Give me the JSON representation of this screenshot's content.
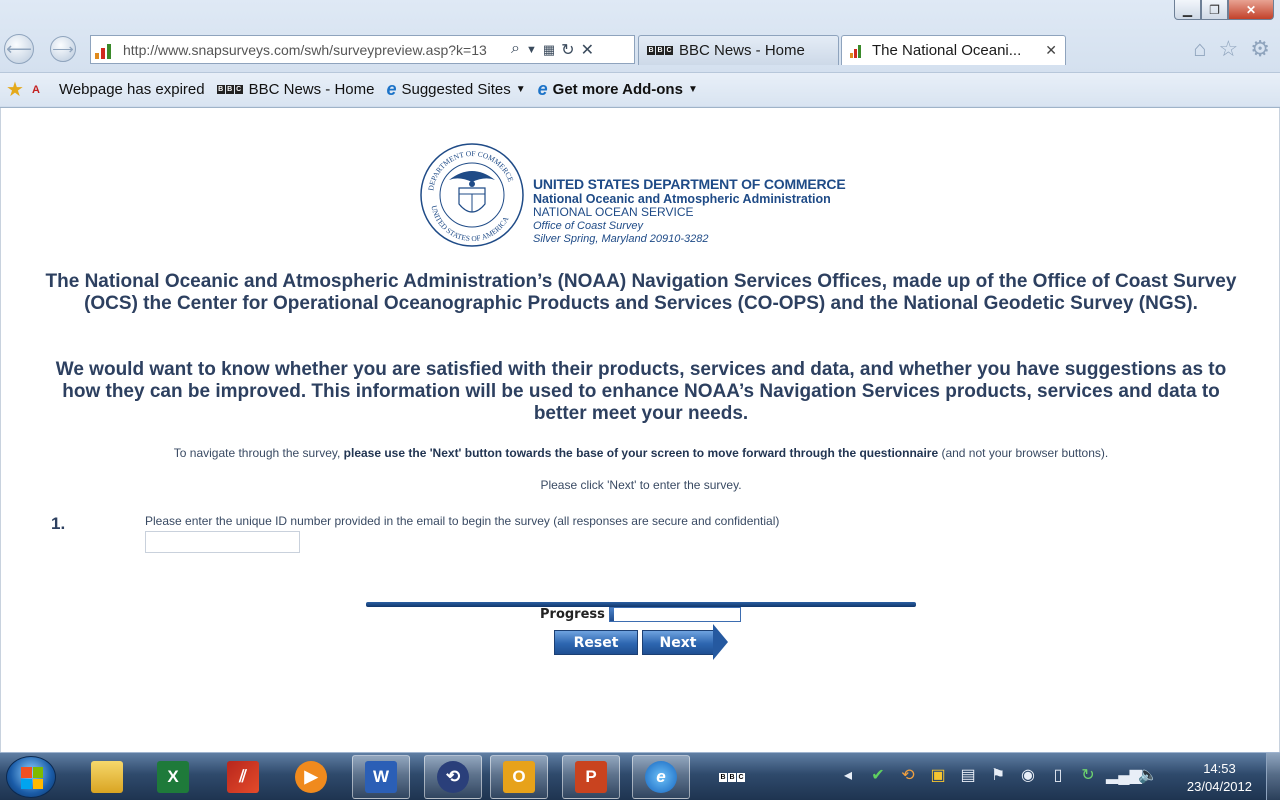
{
  "browser": {
    "address_url": "http://www.snapsurveys.com/swh/surveypreview.asp?k=13",
    "tabs": [
      {
        "label": "BBC News - Home"
      },
      {
        "label": "The National Oceani..."
      }
    ],
    "favorites": [
      {
        "label": "Webpage has expired",
        "icon": "expired-page-icon"
      },
      {
        "label": "BBC News - Home",
        "icon": "bbc-icon"
      },
      {
        "label": "Suggested Sites",
        "icon": "ie-icon"
      },
      {
        "label": "Get more Add-ons",
        "icon": "ie-icon"
      }
    ],
    "bbc_letters": [
      "B",
      "B",
      "C"
    ]
  },
  "page": {
    "header": {
      "dept": "UNITED STATES DEPARTMENT OF COMMERCE",
      "agency": "National Oceanic and Atmospheric Administration",
      "service": "NATIONAL OCEAN SERVICE",
      "office": "Office of Coast Survey",
      "address": "Silver Spring, Maryland 20910-3282"
    },
    "seal": {
      "top_text": "DEPARTMENT OF COMMERCE",
      "bottom_text": "UNITED STATES OF AMERICA"
    },
    "intro_1": "The National Oceanic and Atmospheric Administration’s (NOAA) Navigation Services Offices, made up of the Office of Coast Survey (OCS) the Center for Operational Oceanographic Products and Services (CO-OPS) and the National Geodetic Survey (NGS).",
    "intro_2": "We would want to know whether you are satisfied with their products, services and data, and whether you have suggestions as to how they can be improved. This information will be used to enhance NOAA’s Navigation Services products, services and data to better meet your needs.",
    "nav_note": {
      "pre": "To navigate through the survey, ",
      "bold": "please use the 'Next' button towards the base of your screen to move forward through the questionnaire",
      "post": " (and not your browser buttons)."
    },
    "click_note": "Please click 'Next' to enter the survey.",
    "question": {
      "number": "1.",
      "text": "Please enter the unique ID number provided in the email to begin the survey (all responses are secure and confidential)",
      "value": ""
    },
    "progress": {
      "label": "Progress",
      "value": 0.03
    },
    "buttons": {
      "reset": "Reset",
      "next": "Next"
    }
  },
  "taskbar": {
    "time": "14:53",
    "date": "23/04/2012",
    "apps": [
      "windows-explorer",
      "excel",
      "app-stripes",
      "media-player",
      "word",
      "network-app",
      "outlook",
      "powerpoint",
      "internet-explorer",
      "bbc"
    ]
  }
}
